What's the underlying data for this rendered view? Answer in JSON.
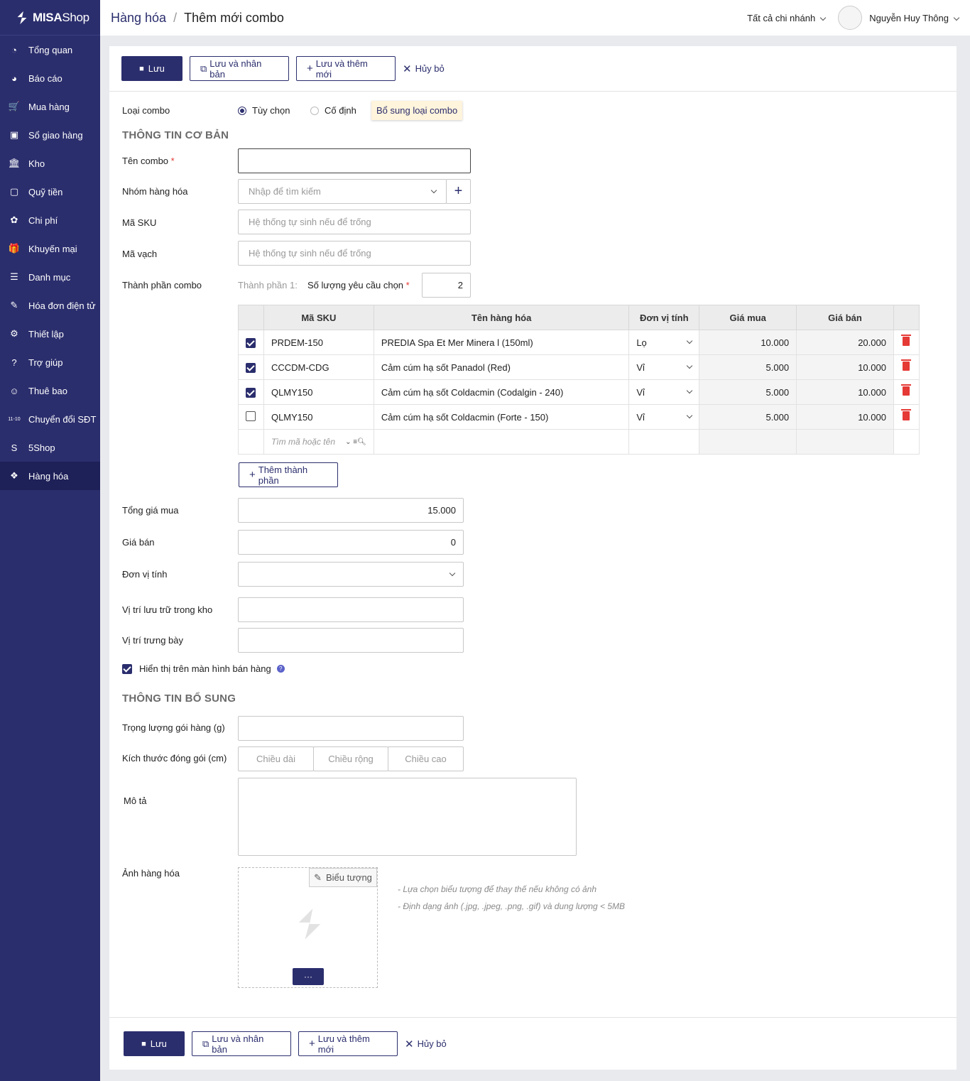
{
  "brand": {
    "name_bold": "MISA",
    "name_light": "Shop"
  },
  "nav": [
    {
      "label": "Tổng quan",
      "icon": "dashboard-icon",
      "glyph": "◔"
    },
    {
      "label": "Báo cáo",
      "icon": "pie-chart-icon",
      "glyph": "◕"
    },
    {
      "label": "Mua hàng",
      "icon": "cart-icon",
      "glyph": "🛒"
    },
    {
      "label": "Sổ giao hàng",
      "icon": "delivery-book-icon",
      "glyph": "▣"
    },
    {
      "label": "Kho",
      "icon": "warehouse-icon",
      "glyph": "🏛"
    },
    {
      "label": "Quỹ tiền",
      "icon": "safe-icon",
      "glyph": "▢"
    },
    {
      "label": "Chi phí",
      "icon": "expense-icon",
      "glyph": "✿"
    },
    {
      "label": "Khuyến mại",
      "icon": "gift-icon",
      "glyph": "🎁"
    },
    {
      "label": "Danh mục",
      "icon": "list-icon",
      "glyph": "☰"
    },
    {
      "label": "Hóa đơn điện tử",
      "icon": "e-invoice-icon",
      "glyph": "✎"
    },
    {
      "label": "Thiết lập",
      "icon": "gear-icon",
      "glyph": "⚙"
    },
    {
      "label": "Trợ giúp",
      "icon": "help-icon",
      "glyph": "?"
    },
    {
      "label": "Thuê bao",
      "icon": "user-icon",
      "glyph": "☺"
    },
    {
      "label": "Chuyển đổi SĐT",
      "icon": "phone-convert-icon",
      "glyph": "11-10"
    },
    {
      "label": "5Shop",
      "icon": "5shop-icon",
      "glyph": "S"
    },
    {
      "label": "Hàng hóa",
      "icon": "goods-icon",
      "glyph": "❖"
    }
  ],
  "header": {
    "crumb_parent": "Hàng hóa",
    "crumb_current": "Thêm mới combo",
    "branch": "Tất cả chi nhánh",
    "user": "Nguyễn Huy Thông"
  },
  "toolbar": {
    "save": "Lưu",
    "save_copy": "Lưu và nhân bản",
    "save_new": "Lưu và thêm mới",
    "cancel": "Hủy bỏ"
  },
  "form": {
    "combo_type_label": "Loại combo",
    "combo_type_options": [
      "Tùy chọn",
      "Cố định"
    ],
    "combo_type_selected": "Tùy chọn",
    "combo_type_tip": "Bổ sung loại combo",
    "section_basic": "THÔNG TIN CƠ BẢN",
    "name_label": "Tên combo",
    "name_value": "",
    "group_label": "Nhóm hàng hóa",
    "group_placeholder": "Nhập để tìm kiếm",
    "sku_label": "Mã SKU",
    "sku_placeholder": "Hệ thống tự sinh nếu để trống",
    "barcode_label": "Mã vạch",
    "barcode_placeholder": "Hệ thống tự sinh nếu để trống",
    "components_label": "Thành phần combo",
    "component_index": "Thành phần 1:",
    "required_qty_label": "Số lượng yêu cầu chọn",
    "required_qty_value": "2",
    "add_component": "Thêm thành phần",
    "total_cost_label": "Tổng giá mua",
    "total_cost_value": "15.000",
    "sale_price_label": "Giá bán",
    "sale_price_value": "0",
    "unit_label": "Đơn vị tính",
    "storage_label": "Vị trí lưu trữ trong kho",
    "display_label": "Vị trí trưng bày",
    "show_on_pos_label": "Hiển thị trên màn hình bán hàng",
    "section_extra": "THÔNG TIN BỔ SUNG",
    "weight_label": "Trọng lượng gói hàng (g)",
    "size_label": "Kích thước đóng gói (cm)",
    "length_placeholder": "Chiều dài",
    "width_placeholder": "Chiều rộng",
    "height_placeholder": "Chiều cao",
    "description_label": "Mô tả",
    "image_label": "Ảnh hàng hóa",
    "icon_button": "Biểu tượng",
    "more_button": "···",
    "image_note_1": "- Lựa chọn biểu tượng để thay thế nếu không có ảnh",
    "image_note_2": "- Định dạng ảnh (.jpg, .jpeg, .png, .gif) và dung lượng < 5MB"
  },
  "table": {
    "headers": [
      "Mã SKU",
      "Tên hàng hóa",
      "Đơn vị tính",
      "Giá mua",
      "Giá bán"
    ],
    "rows": [
      {
        "checked": true,
        "sku": "PRDEM-150",
        "name": "PREDIA Spa Et Mer Minera l (150ml)",
        "unit": "Lọ",
        "cost": "10.000",
        "price": "20.000"
      },
      {
        "checked": true,
        "sku": "CCCDM-CDG",
        "name": "Cảm cúm hạ sốt Panadol (Red)",
        "unit": "Vỉ",
        "cost": "5.000",
        "price": "10.000"
      },
      {
        "checked": true,
        "sku": "QLMY150",
        "name": "Cảm cúm hạ sốt Coldacmin (Codalgin - 240)",
        "unit": "Vỉ",
        "cost": "5.000",
        "price": "10.000"
      },
      {
        "checked": false,
        "sku": "QLMY150",
        "name": "Cảm cúm hạ sốt Coldacmin (Forte - 150)",
        "unit": "Vỉ",
        "cost": "5.000",
        "price": "10.000"
      }
    ],
    "search_placeholder": "Tìm mã hoặc tên"
  },
  "colors": {
    "primary": "#2b2e6d",
    "danger": "#e53935"
  }
}
